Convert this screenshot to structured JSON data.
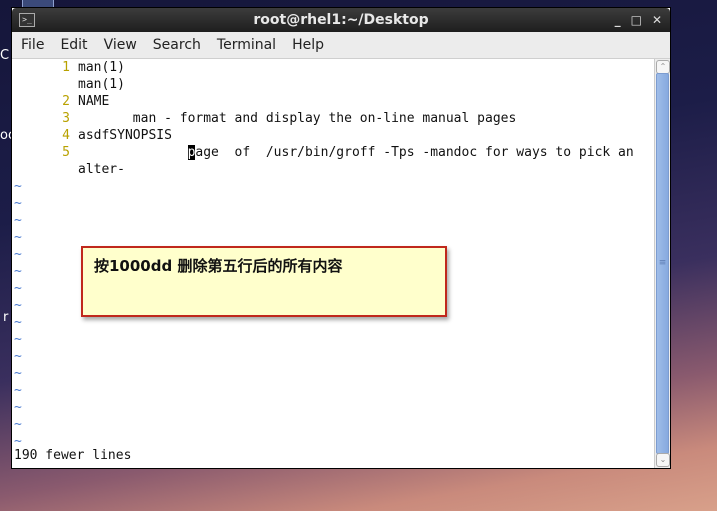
{
  "desktop": {
    "labels": [
      "C",
      "oo",
      "r"
    ]
  },
  "window": {
    "title": "root@rhel1:~/Desktop",
    "controls": {
      "minimize": "_",
      "maximize": "□",
      "close": "✕"
    },
    "icon": "terminal-icon"
  },
  "menu": [
    "File",
    "Edit",
    "View",
    "Search",
    "Terminal",
    "Help"
  ],
  "editor": {
    "lines": [
      {
        "num": "1",
        "text": "man(1)"
      },
      {
        "num": "",
        "text": "man(1)"
      },
      {
        "num": "2",
        "text": "NAME"
      },
      {
        "num": "3",
        "text": "       man - format and display the on-line manual pages"
      },
      {
        "num": "4",
        "text": "asdfSYNOPSIS"
      },
      {
        "num": "5",
        "pre": "              ",
        "cursor": "p",
        "text": "age  of  /usr/bin/groff -Tps -mandoc for ways to pick an"
      },
      {
        "num": "",
        "text": "alter-"
      }
    ],
    "tilde": "~",
    "tilde_count": 16,
    "status": "190 fewer lines"
  },
  "annotation": {
    "text": "按1000dd 删除第五行后的所有内容"
  },
  "scrollbar": {
    "up": "⌃",
    "down": "⌄",
    "grip": "≡"
  }
}
